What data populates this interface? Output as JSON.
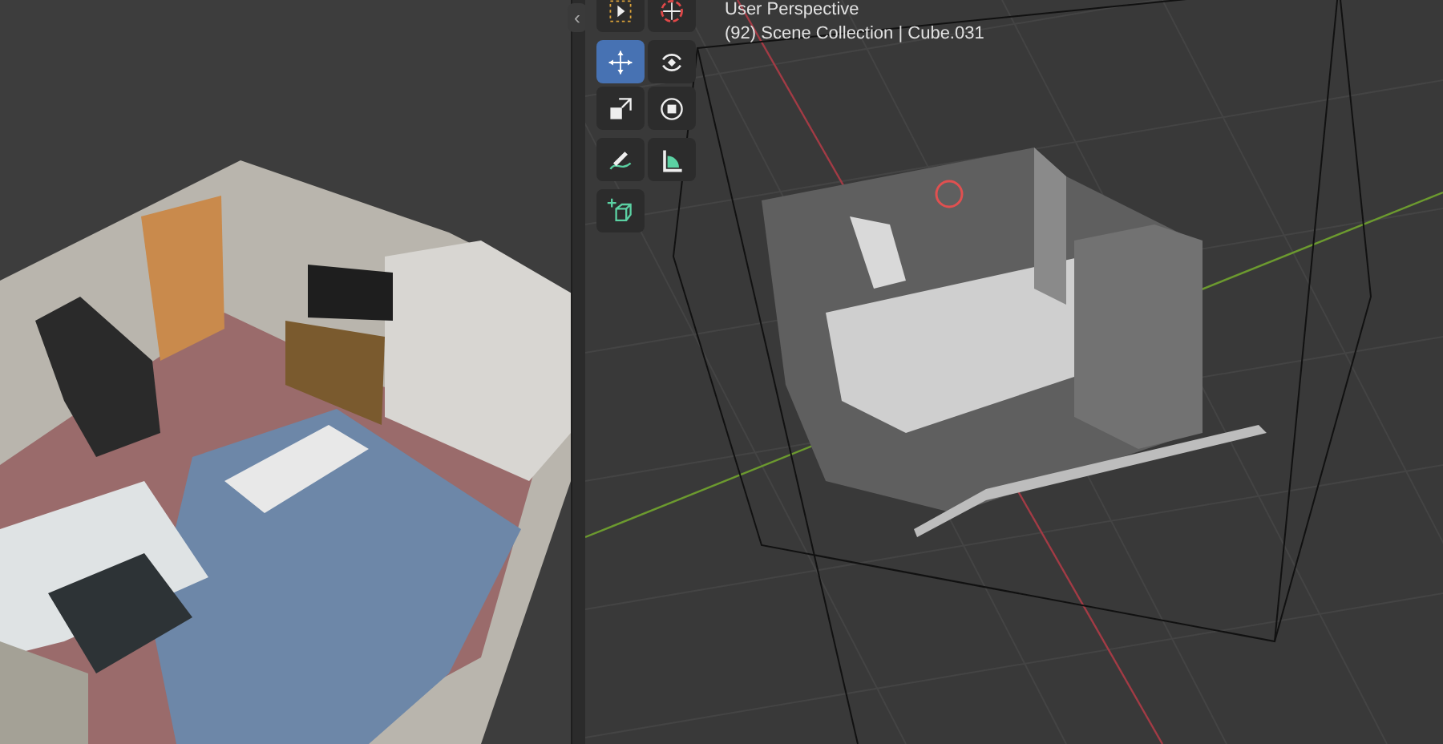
{
  "sidebar_toggle": {
    "glyph": "‹"
  },
  "toolbar": {
    "groups": [
      [
        {
          "kind": "select-box",
          "selected": false
        },
        {
          "kind": "cursor",
          "selected": false
        }
      ],
      [
        {
          "kind": "move",
          "selected": true
        },
        {
          "kind": "rotate",
          "selected": false
        },
        {
          "kind": "scale",
          "selected": false
        },
        {
          "kind": "transform",
          "selected": false
        }
      ],
      [
        {
          "kind": "annotate",
          "selected": false
        },
        {
          "kind": "measure",
          "selected": false
        }
      ],
      [
        {
          "kind": "add-cube",
          "selected": false
        }
      ]
    ]
  },
  "viewport_header": {
    "view_name": "User Perspective",
    "collection_info": "(92) Scene Collection | Cube.031"
  }
}
